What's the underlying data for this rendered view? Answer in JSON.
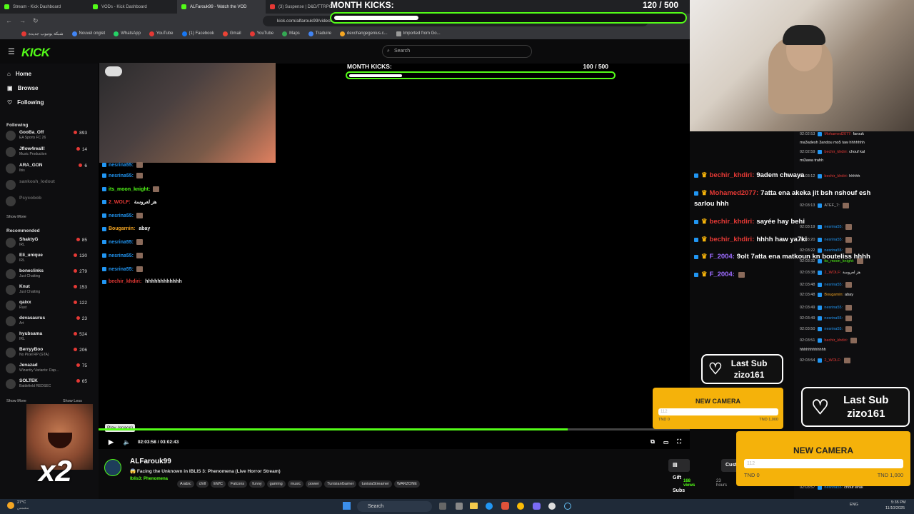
{
  "browser": {
    "tabs": [
      "Stream - Kick Dashboard",
      "VODs - Kick Dashboard",
      "ALFarouk99 - Watch the VOD",
      "(3) Suspense | D&D/TTRPG"
    ],
    "url": "kick.com/alfarouk99/videos/9d9ed24-1bf8-448f-bd8b-9ebf44dfb8b",
    "bookmarks": [
      "شبكة يوتيوب جديدة",
      "Nouvel onglet",
      "WhatsApp",
      "YouTube",
      "(1) Facebook",
      "Gmail",
      "YouTube",
      "Maps",
      "Traduire",
      "dexchangegenius.c...",
      "Imported from Go..."
    ]
  },
  "top_goal": {
    "label": "MONTH KICKS:",
    "count": "120  / 500",
    "progress": 0.24
  },
  "kick": {
    "logo": "KICK",
    "search_placeholder": "Search",
    "nav": {
      "home": "Home",
      "browse": "Browse",
      "following": "Following"
    },
    "following_title": "Following",
    "following": [
      {
        "name": "GooBa_Off",
        "cat": "EA Sports FC 26",
        "viewers": "893",
        "online": true
      },
      {
        "name": "Jflow4reall!",
        "cat": "Music Production",
        "viewers": "14",
        "online": true
      },
      {
        "name": "ARA_GON",
        "cat": "Ibis",
        "viewers": "6",
        "online": true
      },
      {
        "name": "sankosh_lodout",
        "cat": "",
        "viewers": "",
        "online": false
      },
      {
        "name": "Psycobob",
        "cat": "",
        "viewers": "",
        "online": false
      }
    ],
    "show_more": "Show More",
    "recommended_title": "Recommended",
    "recommended": [
      {
        "name": "ShaktyG",
        "cat": "IRL",
        "viewers": "85"
      },
      {
        "name": "Eli_unique",
        "cat": "IRL",
        "viewers": "130"
      },
      {
        "name": "boneclinks",
        "cat": "Just Chatting",
        "viewers": "279"
      },
      {
        "name": "Knut",
        "cat": "Just Chatting",
        "viewers": "153"
      },
      {
        "name": "qaixx",
        "cat": "Rust",
        "viewers": "122"
      },
      {
        "name": "devasaurus",
        "cat": "Art",
        "viewers": "23"
      },
      {
        "name": "hyubsama",
        "cat": "IRL",
        "viewers": "524"
      },
      {
        "name": "BerryyBoo",
        "cat": "No Pixel RP (GTA)",
        "viewers": "206"
      },
      {
        "name": "Jenazad",
        "cat": "Wizardry Variants: Dap...",
        "viewers": "75"
      },
      {
        "name": "SOLTEK",
        "cat": "Battlefield REDSEC",
        "viewers": "65"
      }
    ],
    "show_more2": "Show More",
    "show_less": "Show Less"
  },
  "video": {
    "goal": {
      "label": "MONTH KICKS:",
      "count": "100  / 500",
      "progress": 0.2
    },
    "chat": [
      {
        "user": "nesrina55:",
        "msg": "",
        "color": "#2196f3"
      },
      {
        "user": "nesrina55:",
        "msg": "",
        "color": "#2196f3"
      },
      {
        "user": "its_moon_knight:",
        "msg": "",
        "color": "#53fc18"
      },
      {
        "user": "2_WOLF:",
        "msg": "هز لعروسة",
        "color": "#e53935"
      },
      {
        "user": "nesrina55:",
        "msg": "",
        "color": "#2196f3"
      },
      {
        "user": "Bougarnin:",
        "msg": "abay",
        "color": "#f5a623"
      },
      {
        "user": "nesrina55:",
        "msg": "",
        "color": "#2196f3"
      },
      {
        "user": "nesrina55:",
        "msg": "",
        "color": "#2196f3"
      },
      {
        "user": "nesrina55:",
        "msg": "",
        "color": "#2196f3"
      },
      {
        "user": "bechir_khdiri:",
        "msg": "hhhhhhhhhhhh",
        "color": "#e53935"
      }
    ],
    "tooltip": "Play (space)",
    "time": "02:03:58  /  03:02:43",
    "progress": 0.793,
    "streamer": "ALFarouk99",
    "title": "😱 Facing the Unknown in IBLIS 3: Phenomena (Live Horror Stream)",
    "category": "Iblis3: Phenomena",
    "tags": [
      "Arabic",
      "chill",
      "EWC",
      "Falcons",
      "funny",
      "gaming",
      "music",
      "power",
      "TunisianGamer",
      "tunisiaStreamer",
      "WARZONE"
    ],
    "views": "168 views",
    "ago": "23 hours",
    "gift_subs": "Gift Subs",
    "custom": "Custom"
  },
  "overlay_chat": [
    {
      "user": "bechir_khdiri:",
      "msg": "9adem chwaya",
      "color": "#e53935"
    },
    {
      "user": "Mohamed2077:",
      "msg": "7atta ena akeka jit bsh nshouf esh",
      "msg2": "sarlou hhh",
      "color": "#e53935"
    },
    {
      "user": "bechir_khdiri:",
      "msg": "sayée hay behi",
      "color": "#e53935"
    },
    {
      "user": "bechir_khdiri:",
      "msg": "hhhh haw ya7ki",
      "color": "#e53935"
    },
    {
      "user": "F_2004:",
      "msg": "9olt 7atta ena matkoun kn bouteliss hhhh",
      "color": "#9c6bff"
    },
    {
      "user": "F_2004:",
      "msg": "",
      "color": "#9c6bff"
    }
  ],
  "right_chat": [
    {
      "ts": "02:02:53",
      "user": "Mohamed2077:",
      "msg": "farouk",
      "color": "#e53935"
    },
    {
      "ts": "",
      "user": "",
      "msg": "ma3adesh 3andou mo5 taw hhhhhhh",
      "color": "#fff"
    },
    {
      "ts": "02:02:59",
      "user": "bechir_khdiri:",
      "msg": "chouf kal",
      "color": "#e53935"
    },
    {
      "ts": "",
      "user": "",
      "msg": "mi3awa trahh",
      "color": "#fff"
    },
    {
      "ts": "02:03:12",
      "user": "bechir_khdiri:",
      "msg": "hhhhh",
      "color": "#e53935"
    },
    {
      "ts": "02:03:13",
      "user": "ATEF_7:",
      "msg": "",
      "color": "#bbb"
    },
    {
      "ts": "02:03:19",
      "user": "nesrina55:",
      "msg": "",
      "color": "#2196f3"
    },
    {
      "ts": "02:03:20",
      "user": "nesrina55:",
      "msg": "",
      "color": "#2196f3"
    },
    {
      "ts": "02:03:22",
      "user": "nesrina55:",
      "msg": "",
      "color": "#2196f3"
    },
    {
      "ts": "02:03:32",
      "user": "its_moon_knight:",
      "msg": "",
      "color": "#53fc18"
    },
    {
      "ts": "02:03:38",
      "user": "2_WOLF:",
      "msg": "هز لعروسة",
      "color": "#e53935"
    },
    {
      "ts": "02:03:48",
      "user": "nesrina55:",
      "msg": "",
      "color": "#2196f3"
    },
    {
      "ts": "02:03:48",
      "user": "Bougarnin:",
      "msg": "abay",
      "color": "#f5a623"
    },
    {
      "ts": "02:03:49",
      "user": "nesrina55:",
      "msg": "",
      "color": "#2196f3"
    },
    {
      "ts": "02:03:49",
      "user": "nesrina55:",
      "msg": "",
      "color": "#2196f3"
    },
    {
      "ts": "02:03:50",
      "user": "nesrina55:",
      "msg": "",
      "color": "#2196f3"
    },
    {
      "ts": "02:03:51",
      "user": "bechir_khdiri:",
      "msg": "",
      "color": "#e53935"
    },
    {
      "ts": "",
      "user": "",
      "msg": "hhhhhhhhhhhh",
      "color": "#fff"
    },
    {
      "ts": "02:03:54",
      "user": "2_WOLF:",
      "msg": "",
      "color": "#e53935"
    },
    {
      "ts": "02:03:57",
      "user": "nesrina55:",
      "msg": "chouf wrak",
      "color": "#2196f3"
    }
  ],
  "last_sub": {
    "label": "Last Sub",
    "name": "zizo161"
  },
  "new_camera": {
    "title": "NEW CAMERA",
    "value": "112",
    "left": "TND 0",
    "right": "TND 1,000",
    "progress": 0.012
  },
  "meme_text": "x2",
  "taskbar": {
    "weather": "27°C",
    "weather_sub": "مشمس",
    "search": "Search",
    "lang": "ENG",
    "time": "5:35 PM",
    "date": "11/10/2025"
  }
}
